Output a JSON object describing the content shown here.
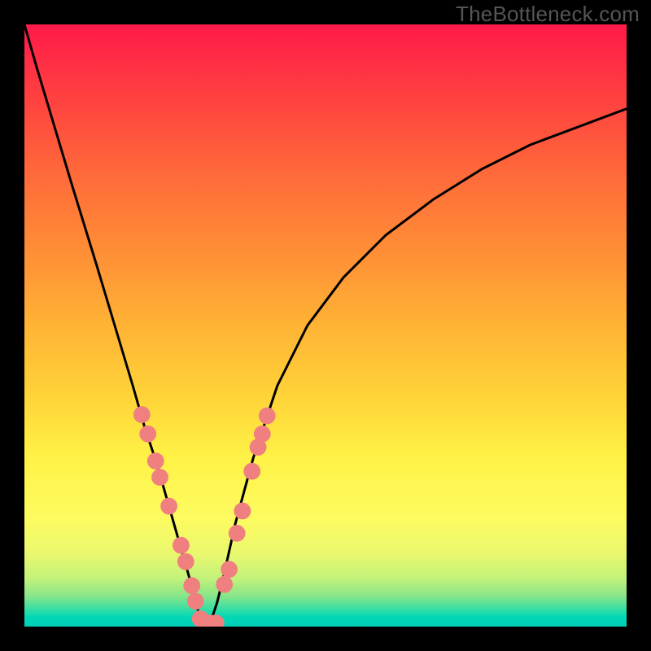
{
  "watermark": "TheBottleneck.com",
  "chart_data": {
    "type": "line",
    "title": "",
    "xlabel": "",
    "ylabel": "",
    "xlim": [
      0,
      1
    ],
    "ylim": [
      0,
      1
    ],
    "curve": {
      "name": "bottleneck-curve",
      "x": [
        0.0,
        0.02,
        0.05,
        0.08,
        0.12,
        0.15,
        0.18,
        0.2,
        0.22,
        0.24,
        0.26,
        0.28,
        0.29,
        0.3,
        0.302,
        0.31,
        0.32,
        0.33,
        0.35,
        0.38,
        0.42,
        0.47,
        0.53,
        0.6,
        0.68,
        0.76,
        0.84,
        0.92,
        1.0
      ],
      "y": [
        1.0,
        0.93,
        0.83,
        0.73,
        0.6,
        0.5,
        0.4,
        0.33,
        0.27,
        0.2,
        0.13,
        0.06,
        0.02,
        0.0,
        0.0,
        0.01,
        0.04,
        0.08,
        0.17,
        0.28,
        0.4,
        0.5,
        0.58,
        0.65,
        0.71,
        0.76,
        0.8,
        0.83,
        0.86
      ]
    },
    "highlight_points": {
      "name": "highlight-dots",
      "color": "#f08080",
      "radius": 0.014,
      "points": [
        {
          "x": 0.195,
          "y": 0.352
        },
        {
          "x": 0.205,
          "y": 0.32
        },
        {
          "x": 0.218,
          "y": 0.275
        },
        {
          "x": 0.225,
          "y": 0.248
        },
        {
          "x": 0.24,
          "y": 0.2
        },
        {
          "x": 0.26,
          "y": 0.135
        },
        {
          "x": 0.268,
          "y": 0.108
        },
        {
          "x": 0.278,
          "y": 0.068
        },
        {
          "x": 0.284,
          "y": 0.042
        },
        {
          "x": 0.292,
          "y": 0.013
        },
        {
          "x": 0.3,
          "y": 0.006
        },
        {
          "x": 0.308,
          "y": 0.006
        },
        {
          "x": 0.318,
          "y": 0.006
        },
        {
          "x": 0.332,
          "y": 0.07
        },
        {
          "x": 0.34,
          "y": 0.095
        },
        {
          "x": 0.353,
          "y": 0.155
        },
        {
          "x": 0.362,
          "y": 0.192
        },
        {
          "x": 0.378,
          "y": 0.258
        },
        {
          "x": 0.388,
          "y": 0.298
        },
        {
          "x": 0.395,
          "y": 0.32
        },
        {
          "x": 0.403,
          "y": 0.35
        }
      ]
    },
    "background_gradient": {
      "stops": [
        {
          "pos": 0.0,
          "color": "#ff1a4a"
        },
        {
          "pos": 0.5,
          "color": "#ffb335"
        },
        {
          "pos": 0.82,
          "color": "#fdfb60"
        },
        {
          "pos": 1.0,
          "color": "#00cfb9"
        }
      ]
    }
  }
}
